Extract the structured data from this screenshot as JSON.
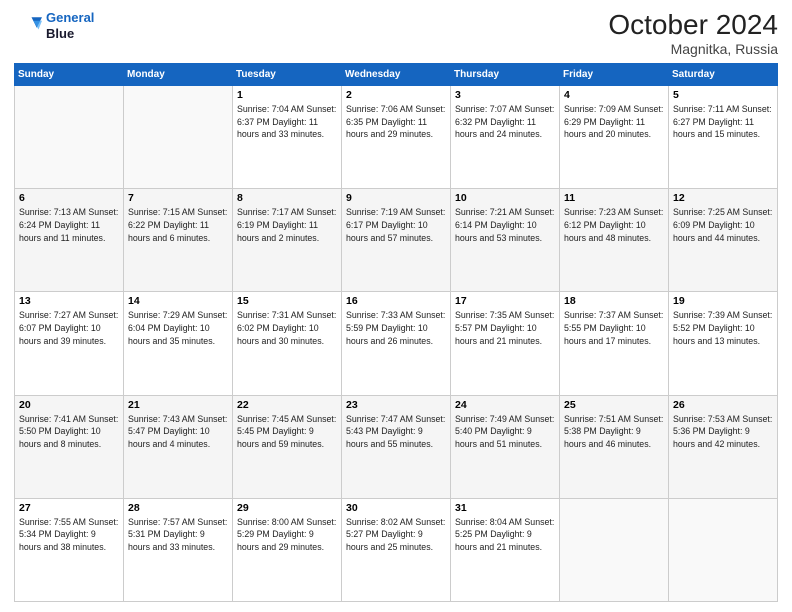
{
  "header": {
    "logo_line1": "General",
    "logo_line2": "Blue",
    "month": "October 2024",
    "location": "Magnitka, Russia"
  },
  "weekdays": [
    "Sunday",
    "Monday",
    "Tuesday",
    "Wednesday",
    "Thursday",
    "Friday",
    "Saturday"
  ],
  "weeks": [
    [
      {
        "day": "",
        "info": ""
      },
      {
        "day": "",
        "info": ""
      },
      {
        "day": "1",
        "info": "Sunrise: 7:04 AM\nSunset: 6:37 PM\nDaylight: 11 hours\nand 33 minutes."
      },
      {
        "day": "2",
        "info": "Sunrise: 7:06 AM\nSunset: 6:35 PM\nDaylight: 11 hours\nand 29 minutes."
      },
      {
        "day": "3",
        "info": "Sunrise: 7:07 AM\nSunset: 6:32 PM\nDaylight: 11 hours\nand 24 minutes."
      },
      {
        "day": "4",
        "info": "Sunrise: 7:09 AM\nSunset: 6:29 PM\nDaylight: 11 hours\nand 20 minutes."
      },
      {
        "day": "5",
        "info": "Sunrise: 7:11 AM\nSunset: 6:27 PM\nDaylight: 11 hours\nand 15 minutes."
      }
    ],
    [
      {
        "day": "6",
        "info": "Sunrise: 7:13 AM\nSunset: 6:24 PM\nDaylight: 11 hours\nand 11 minutes."
      },
      {
        "day": "7",
        "info": "Sunrise: 7:15 AM\nSunset: 6:22 PM\nDaylight: 11 hours\nand 6 minutes."
      },
      {
        "day": "8",
        "info": "Sunrise: 7:17 AM\nSunset: 6:19 PM\nDaylight: 11 hours\nand 2 minutes."
      },
      {
        "day": "9",
        "info": "Sunrise: 7:19 AM\nSunset: 6:17 PM\nDaylight: 10 hours\nand 57 minutes."
      },
      {
        "day": "10",
        "info": "Sunrise: 7:21 AM\nSunset: 6:14 PM\nDaylight: 10 hours\nand 53 minutes."
      },
      {
        "day": "11",
        "info": "Sunrise: 7:23 AM\nSunset: 6:12 PM\nDaylight: 10 hours\nand 48 minutes."
      },
      {
        "day": "12",
        "info": "Sunrise: 7:25 AM\nSunset: 6:09 PM\nDaylight: 10 hours\nand 44 minutes."
      }
    ],
    [
      {
        "day": "13",
        "info": "Sunrise: 7:27 AM\nSunset: 6:07 PM\nDaylight: 10 hours\nand 39 minutes."
      },
      {
        "day": "14",
        "info": "Sunrise: 7:29 AM\nSunset: 6:04 PM\nDaylight: 10 hours\nand 35 minutes."
      },
      {
        "day": "15",
        "info": "Sunrise: 7:31 AM\nSunset: 6:02 PM\nDaylight: 10 hours\nand 30 minutes."
      },
      {
        "day": "16",
        "info": "Sunrise: 7:33 AM\nSunset: 5:59 PM\nDaylight: 10 hours\nand 26 minutes."
      },
      {
        "day": "17",
        "info": "Sunrise: 7:35 AM\nSunset: 5:57 PM\nDaylight: 10 hours\nand 21 minutes."
      },
      {
        "day": "18",
        "info": "Sunrise: 7:37 AM\nSunset: 5:55 PM\nDaylight: 10 hours\nand 17 minutes."
      },
      {
        "day": "19",
        "info": "Sunrise: 7:39 AM\nSunset: 5:52 PM\nDaylight: 10 hours\nand 13 minutes."
      }
    ],
    [
      {
        "day": "20",
        "info": "Sunrise: 7:41 AM\nSunset: 5:50 PM\nDaylight: 10 hours\nand 8 minutes."
      },
      {
        "day": "21",
        "info": "Sunrise: 7:43 AM\nSunset: 5:47 PM\nDaylight: 10 hours\nand 4 minutes."
      },
      {
        "day": "22",
        "info": "Sunrise: 7:45 AM\nSunset: 5:45 PM\nDaylight: 9 hours\nand 59 minutes."
      },
      {
        "day": "23",
        "info": "Sunrise: 7:47 AM\nSunset: 5:43 PM\nDaylight: 9 hours\nand 55 minutes."
      },
      {
        "day": "24",
        "info": "Sunrise: 7:49 AM\nSunset: 5:40 PM\nDaylight: 9 hours\nand 51 minutes."
      },
      {
        "day": "25",
        "info": "Sunrise: 7:51 AM\nSunset: 5:38 PM\nDaylight: 9 hours\nand 46 minutes."
      },
      {
        "day": "26",
        "info": "Sunrise: 7:53 AM\nSunset: 5:36 PM\nDaylight: 9 hours\nand 42 minutes."
      }
    ],
    [
      {
        "day": "27",
        "info": "Sunrise: 7:55 AM\nSunset: 5:34 PM\nDaylight: 9 hours\nand 38 minutes."
      },
      {
        "day": "28",
        "info": "Sunrise: 7:57 AM\nSunset: 5:31 PM\nDaylight: 9 hours\nand 33 minutes."
      },
      {
        "day": "29",
        "info": "Sunrise: 8:00 AM\nSunset: 5:29 PM\nDaylight: 9 hours\nand 29 minutes."
      },
      {
        "day": "30",
        "info": "Sunrise: 8:02 AM\nSunset: 5:27 PM\nDaylight: 9 hours\nand 25 minutes."
      },
      {
        "day": "31",
        "info": "Sunrise: 8:04 AM\nSunset: 5:25 PM\nDaylight: 9 hours\nand 21 minutes."
      },
      {
        "day": "",
        "info": ""
      },
      {
        "day": "",
        "info": ""
      }
    ]
  ]
}
